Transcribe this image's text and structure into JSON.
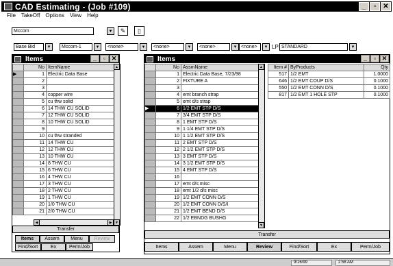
{
  "window": {
    "title": "CAD Estimating - (Job #109)"
  },
  "menu": [
    "File",
    "TakeOff",
    "Options",
    "View",
    "Help"
  ],
  "toolbar": {
    "company": "Mccom",
    "base_bid": "Base Bid",
    "sheet": "Mccom-1",
    "filter1": "<none>",
    "filter2": "<none>",
    "filter3": "<none>",
    "filter4": "<none>",
    "lp_label": "LP",
    "lp_value": "STANDARD"
  },
  "left_panel": {
    "title": "Items",
    "columns": [
      "No",
      "ItemName"
    ],
    "rows": [
      [
        "1",
        "Electric Data Base"
      ],
      [
        "2",
        ""
      ],
      [
        "3",
        ""
      ],
      [
        "4",
        "copper wire"
      ],
      [
        "5",
        "cu thw solid"
      ],
      [
        "6",
        "14 THW CU SOLID"
      ],
      [
        "7",
        "12 THW CU SOLID"
      ],
      [
        "8",
        "10 THW CU SOLID"
      ],
      [
        "9",
        ""
      ],
      [
        "10",
        "cu thw stranded"
      ],
      [
        "11",
        "14 THW CU"
      ],
      [
        "12",
        "12 THW CU"
      ],
      [
        "13",
        "10 THW CU"
      ],
      [
        "14",
        "8 THW CU"
      ],
      [
        "15",
        "6 THW CU"
      ],
      [
        "16",
        "4 THW CU"
      ],
      [
        "17",
        "3 THW CU"
      ],
      [
        "18",
        "2 THW CU"
      ],
      [
        "19",
        "1 THW CU"
      ],
      [
        "20",
        "1/0 THW CU"
      ],
      [
        "21",
        "2/0 THW CU"
      ]
    ],
    "transfer_label": "Transfer",
    "tabs": [
      "Items",
      "Assem",
      "Menu",
      "Review"
    ],
    "tabs2": [
      "Find/Sort",
      "Ex",
      "Perm/Job"
    ]
  },
  "right_panel": {
    "title": "Items",
    "columns": [
      "No",
      "AssmName"
    ],
    "rows": [
      [
        "1",
        "Electric Data Base, 7/23/98"
      ],
      [
        "2",
        "FIXTURE A"
      ],
      [
        "3",
        ""
      ],
      [
        "4",
        "emt branch strap"
      ],
      [
        "5",
        "emt d/s strap"
      ],
      [
        "6",
        "1/2 EMT STP D/S"
      ],
      [
        "7",
        "3/4 EMT STP D/S"
      ],
      [
        "8",
        "1 EMT STP D/S"
      ],
      [
        "9",
        "1 1/4 EMT STP D/S"
      ],
      [
        "10",
        "1 1/2 EMT STP D/S"
      ],
      [
        "11",
        "2 EMT STP D/S"
      ],
      [
        "12",
        "2 1/2 EMT STP D/S"
      ],
      [
        "13",
        "3 EMT STP D/S"
      ],
      [
        "14",
        "3 1/2 EMT STP D/S"
      ],
      [
        "15",
        "4 EMT STP D/S"
      ],
      [
        "16",
        ""
      ],
      [
        "17",
        "emt d/s misc"
      ],
      [
        "18",
        "emt 1/2 d/s misc"
      ],
      [
        "19",
        "1/2 EMT CONN D/S"
      ],
      [
        "20",
        "1/2 EMT CONN D/S/I"
      ],
      [
        "21",
        "1/2 EMT BEND D/S"
      ],
      [
        "22",
        "1/2 EBNDG BUSHG"
      ]
    ],
    "byproducts_columns": [
      "Item #",
      "ByProducts",
      "Qty"
    ],
    "byproducts": [
      [
        "517",
        "1/2 EMT",
        "1.0000"
      ],
      [
        "646",
        "1/2 EMT COUP D/S",
        "0.1000"
      ],
      [
        "550",
        "1/2 EMT CONN D/S",
        "0.1000"
      ],
      [
        "817",
        "1/2 EMT 1 HOLE STP",
        "0.1000"
      ]
    ],
    "transfer_label": "Transfer",
    "buttons": [
      "Items",
      "Assem",
      "Menu",
      "Review",
      "Find/Sort",
      "Ex",
      "Perm/Job"
    ]
  },
  "status": {
    "date": "9/16/99",
    "time": "2:58 AM"
  }
}
